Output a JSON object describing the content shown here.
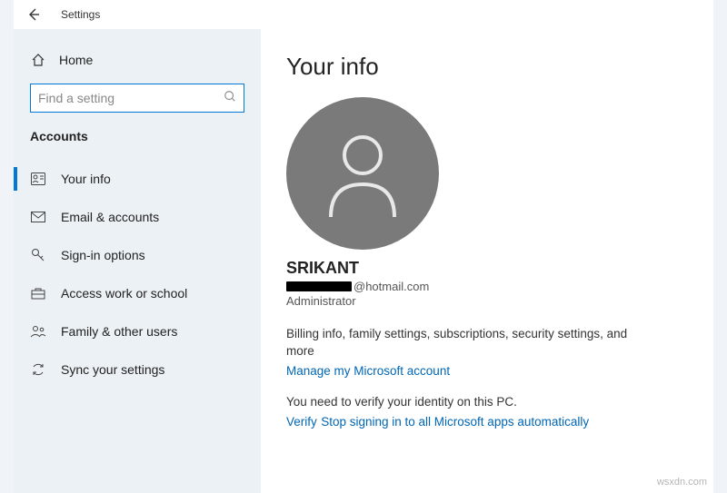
{
  "titlebar": {
    "title": "Settings"
  },
  "sidebar": {
    "home": "Home",
    "search_placeholder": "Find a setting",
    "category": "Accounts",
    "items": [
      {
        "label": "Your info"
      },
      {
        "label": "Email & accounts"
      },
      {
        "label": "Sign-in options"
      },
      {
        "label": "Access work or school"
      },
      {
        "label": "Family & other users"
      },
      {
        "label": "Sync your settings"
      }
    ]
  },
  "main": {
    "title": "Your info",
    "username": "SRIKANT",
    "email_suffix": "@hotmail.com",
    "role": "Administrator",
    "billing_desc": "Billing info, family settings, subscriptions, security settings, and more",
    "manage_link": "Manage my Microsoft account",
    "verify_desc": "You need to verify your identity on this PC.",
    "verify_link": "Verify",
    "stop_link": "Stop signing in to all Microsoft apps automatically"
  },
  "watermark": "wsxdn.com"
}
